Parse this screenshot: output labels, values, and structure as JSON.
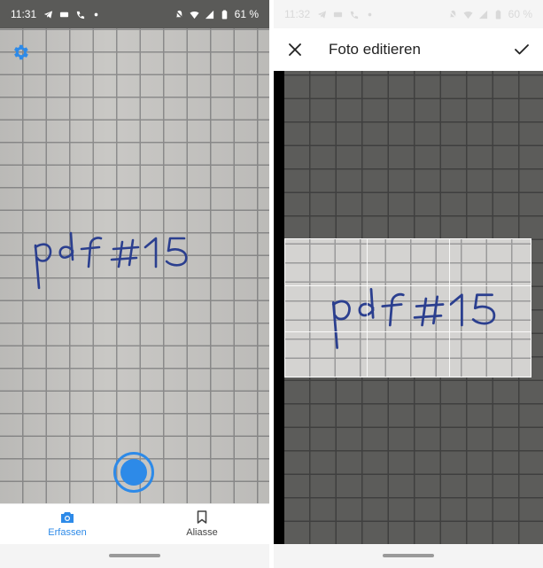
{
  "left_screen": {
    "status": {
      "time": "11:31",
      "battery": "61 %"
    },
    "icons": {
      "settings": "gear-icon",
      "capture": "camera-icon",
      "aliases": "bookmark-icon"
    },
    "handwriting": "pdf #15",
    "nav": {
      "capture_label": "Erfassen",
      "aliases_label": "Aliasse",
      "accent_color": "#2d8ae8"
    }
  },
  "right_screen": {
    "status": {
      "time": "11:32",
      "battery": "60 %"
    },
    "title": "Foto editieren",
    "icons": {
      "close": "close-icon",
      "confirm": "check-icon"
    },
    "handwriting": "pdf #15"
  }
}
